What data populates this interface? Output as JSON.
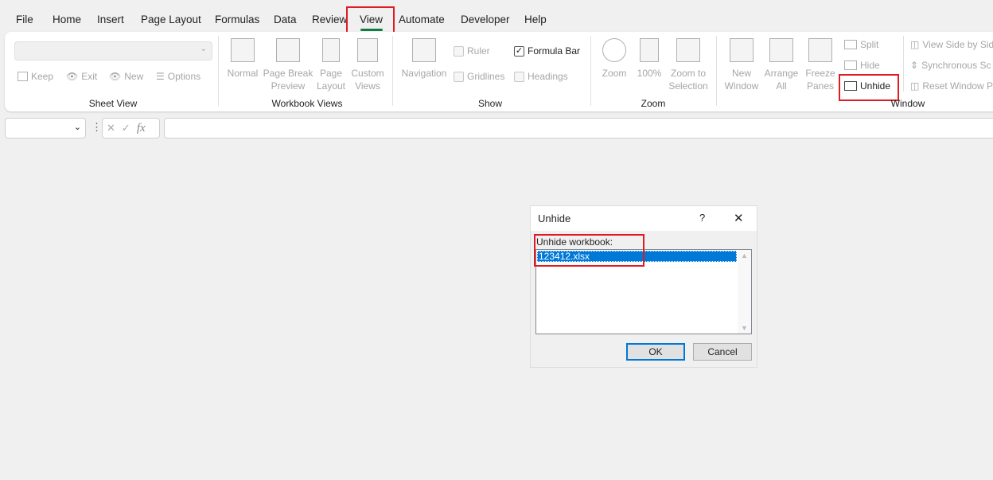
{
  "menu": {
    "tabs": [
      "File",
      "Home",
      "Insert",
      "Page Layout",
      "Formulas",
      "Data",
      "Review",
      "View",
      "Automate",
      "Developer",
      "Help"
    ],
    "active": "View"
  },
  "ribbon": {
    "sheet_view": {
      "label": "Sheet View",
      "keep": "Keep",
      "exit": "Exit",
      "new": "New",
      "options": "Options"
    },
    "workbook_views": {
      "label": "Workbook Views",
      "normal": "Normal",
      "page_break_1": "Page Break",
      "page_break_2": "Preview",
      "page_layout_1": "Page",
      "page_layout_2": "Layout",
      "custom_1": "Custom",
      "custom_2": "Views"
    },
    "show": {
      "label": "Show",
      "navigation": "Navigation",
      "ruler": "Ruler",
      "formula_bar": "Formula Bar",
      "gridlines": "Gridlines",
      "headings": "Headings",
      "formula_bar_checked": true
    },
    "zoom": {
      "label": "Zoom",
      "zoom": "Zoom",
      "hundred": "100%",
      "zoom_sel_1": "Zoom to",
      "zoom_sel_2": "Selection"
    },
    "window": {
      "label": "Window",
      "new_1": "New",
      "new_2": "Window",
      "arrange_1": "Arrange",
      "arrange_2": "All",
      "freeze_1": "Freeze",
      "freeze_2": "Panes",
      "split": "Split",
      "hide": "Hide",
      "unhide": "Unhide",
      "side_by_side": "View Side by Sid",
      "sync": "Synchronous Sc",
      "reset": "Reset Window P"
    }
  },
  "formula_bar": {
    "fx": "fx"
  },
  "dialog": {
    "title": "Unhide",
    "help": "?",
    "label": "Unhide workbook:",
    "items": [
      "123412.xlsx"
    ],
    "ok": "OK",
    "cancel": "Cancel"
  },
  "colors": {
    "accent": "#0078d7",
    "highlight": "#e21b23",
    "active_tab_underline": "#107c41"
  }
}
